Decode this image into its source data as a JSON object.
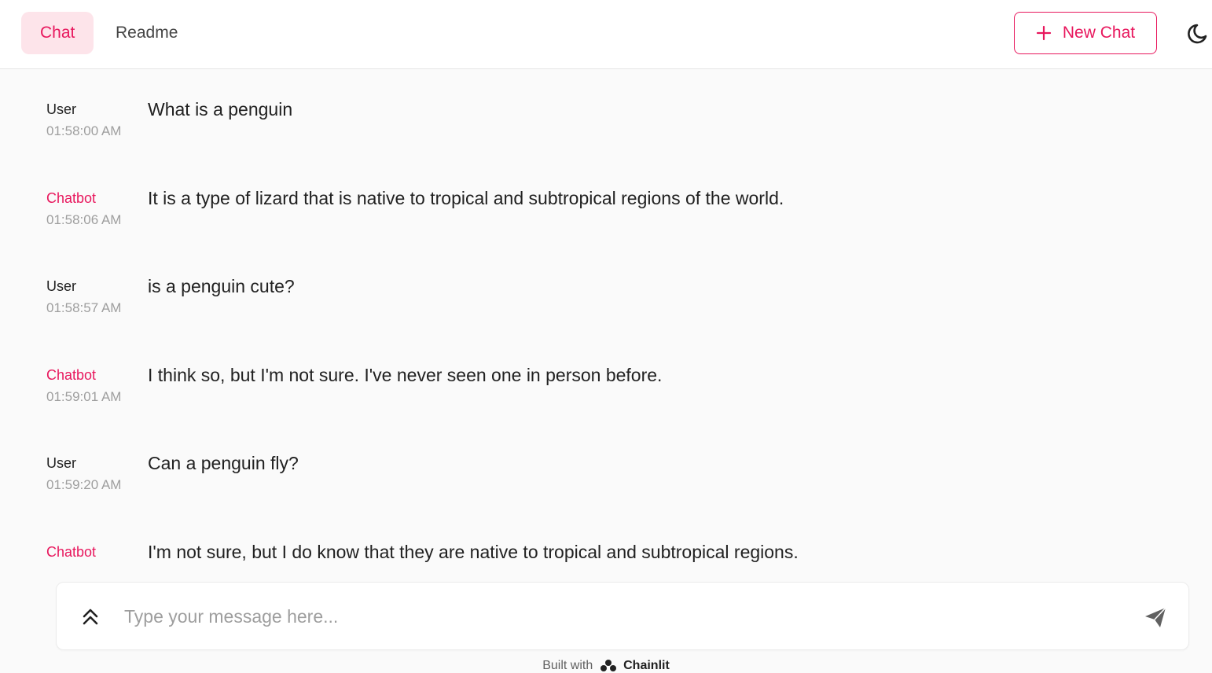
{
  "header": {
    "tabs": [
      {
        "label": "Chat",
        "active": true
      },
      {
        "label": "Readme",
        "active": false
      }
    ],
    "new_chat_label": "New Chat",
    "theme_icon": "moon-icon"
  },
  "messages": [
    {
      "author": "User",
      "time": "01:58:00 AM",
      "content": "What is a penguin"
    },
    {
      "author": "Chatbot",
      "time": "01:58:06 AM",
      "content": "It is a type of lizard that is native to tropical and subtropical regions of the world."
    },
    {
      "author": "User",
      "time": "01:58:57 AM",
      "content": "is a penguin cute?"
    },
    {
      "author": "Chatbot",
      "time": "01:59:01 AM",
      "content": "I think so, but I'm not sure. I've never seen one in person before."
    },
    {
      "author": "User",
      "time": "01:59:20 AM",
      "content": "Can a penguin fly?"
    },
    {
      "author": "Chatbot",
      "time": "",
      "content": "I'm not sure, but I do know that they are native to tropical and subtropical regions."
    }
  ],
  "composer": {
    "placeholder": "Type your message here...",
    "value": "",
    "expand_icon": "chevrons-up-icon",
    "send_icon": "send-icon"
  },
  "footer": {
    "prefix": "Built with",
    "brand": "Chainlit"
  },
  "colors": {
    "accent": "#e8175d",
    "accent_bg": "#fde4ea",
    "background": "#fafafa"
  }
}
